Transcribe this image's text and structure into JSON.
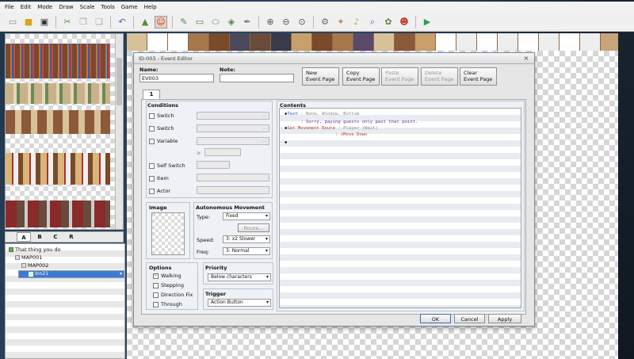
{
  "menubar": [
    "File",
    "Edit",
    "Mode",
    "Draw",
    "Scale",
    "Tools",
    "Game",
    "Help"
  ],
  "tile_tabs": [
    "A",
    "B",
    "C",
    "R"
  ],
  "map_tree": {
    "items": [
      {
        "label": "That thing you do",
        "selected": false
      },
      {
        "label": "MAP001",
        "selected": false
      },
      {
        "label": "MAP002",
        "selected": false
      },
      {
        "label": "Inn21",
        "selected": true
      }
    ]
  },
  "dialog": {
    "title": "ID:003 - Event Editor",
    "close_glyph": "×",
    "name_label": "Name:",
    "name_value": "EV003",
    "note_label": "Note:",
    "note_value": "",
    "buttons": {
      "new": "New\nEvent Page",
      "copy": "Copy\nEvent Page",
      "paste": "Paste\nEvent Page",
      "delete": "Delete\nEvent Page",
      "clear": "Clear\nEvent Page"
    },
    "page_tab": "1",
    "conditions": {
      "title": "Conditions",
      "switch1": "Switch",
      "switch2": "Switch",
      "variable": "Variable",
      "ge_sign": "≥",
      "self_switch": "Self Switch",
      "item": "Item",
      "actor": "Actor",
      "ellipsis": "..."
    },
    "image": {
      "title": "Image"
    },
    "autonomous": {
      "title": "Autonomous Movement",
      "type_label": "Type:",
      "type_value": "Fixed",
      "route_button": "Route...",
      "speed_label": "Speed:",
      "speed_value": "3: x2 Slower",
      "freq_label": "Freq:",
      "freq_value": "3: Normal"
    },
    "options": {
      "title": "Options",
      "walking": "Walking",
      "stepping": "Stepping",
      "direction_fix": "Direction Fix",
      "through": "Through",
      "walking_checked": true
    },
    "priority": {
      "title": "Priority",
      "value": "Below characters"
    },
    "trigger": {
      "title": "Trigger",
      "value": "Action Button"
    },
    "contents": {
      "title": "Contents",
      "lines": [
        {
          "marker": "◆",
          "cmd": "Text",
          "rest": " : None, Window, Bottom"
        },
        {
          "marker": " ",
          "cmd": "    ",
          "rest": " : Sorry, paying guests only past that point."
        },
        {
          "marker": "◆",
          "cmd": "Set Movement Route",
          "rest": " : Player (Wait)"
        },
        {
          "marker": " ",
          "cmd": "    ",
          "rest": "              : ◇Move Down"
        },
        {
          "marker": "◆",
          "cmd": "",
          "rest": ""
        }
      ]
    },
    "footer": {
      "ok": "OK",
      "cancel": "Cancel",
      "apply": "Apply"
    }
  },
  "colors": {
    "selection": "#3a7bd5",
    "dialog_border": "#7a8ea6"
  }
}
